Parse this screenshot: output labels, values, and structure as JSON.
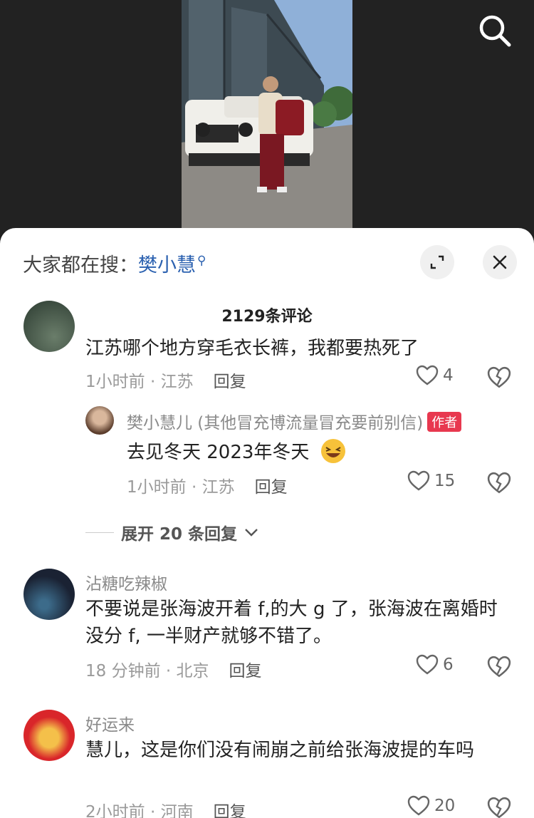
{
  "sheet": {
    "suggest_prefix": "大家都在搜：",
    "suggest_keyword": "樊小慧",
    "title": "2129条评论"
  },
  "comments": [
    {
      "text": "江苏哪个地方穿毛衣长裤，我都要热死了",
      "time": "1小时前 · 江苏",
      "reply": "回复",
      "likes": "4"
    },
    {
      "username": "樊小慧儿 (其他冒充博流量冒充要前别信)",
      "badge": "作者",
      "text": "去见冬天 2023年冬天",
      "time": "1小时前 · 江苏",
      "reply": "回复",
      "likes": "15"
    },
    {
      "username": "沾糖吃辣椒",
      "text": "不要说是张海波开着 f,的大 g 了，张海波在离婚时没分 f, 一半财产就够不错了。",
      "time": "18 分钟前 · 北京",
      "reply": "回复",
      "likes": "6"
    },
    {
      "username": "好运来",
      "text": "慧儿，这是你们没有闹崩之前给张海波提的车吗",
      "time": "2小时前 · 河南",
      "reply": "回复",
      "likes": "20"
    }
  ],
  "expand_replies": "展开 20 条回复",
  "icons": {
    "search": "search-icon",
    "expand": "expand-icon",
    "close": "close-icon",
    "like": "heart-icon",
    "dislike": "broken-heart-icon",
    "chevron": "chevron-down-icon",
    "emoji": "laughing-emoji-icon"
  },
  "colors": {
    "keyword": "#2b61b0",
    "badge": "#e8384f"
  }
}
